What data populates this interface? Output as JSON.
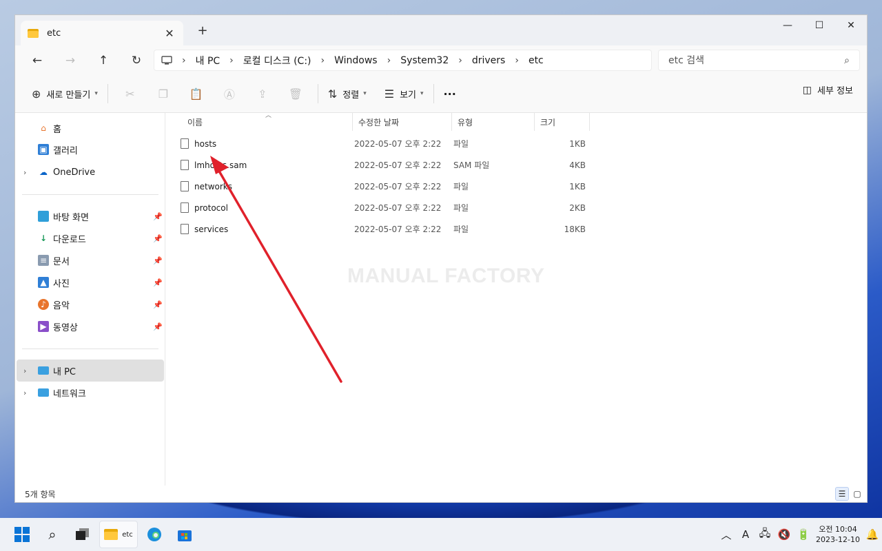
{
  "window": {
    "tab_title": "etc",
    "tab_close": "✕",
    "new_tab": "+",
    "controls": {
      "minimize": "—",
      "maximize": "☐",
      "close": "✕"
    }
  },
  "nav": {
    "back": "←",
    "forward": "→",
    "up": "↑",
    "refresh": "↻",
    "breadcrumb": [
      "내 PC",
      "로컬 디스크 (C:)",
      "Windows",
      "System32",
      "drivers",
      "etc"
    ],
    "search_placeholder": "etc 검색"
  },
  "toolbar": {
    "new_label": "새로 만들기",
    "sort_label": "정렬",
    "view_label": "보기",
    "more_label": "···",
    "details_label": "세부 정보"
  },
  "sidebar": {
    "top": [
      {
        "label": "홈",
        "icon": "home-icon"
      },
      {
        "label": "갤러리",
        "icon": "gallery-icon"
      },
      {
        "label": "OneDrive",
        "icon": "onedrive-icon"
      }
    ],
    "quick": [
      {
        "label": "바탕 화면",
        "icon": "desktop-icon"
      },
      {
        "label": "다운로드",
        "icon": "download-icon"
      },
      {
        "label": "문서",
        "icon": "documents-icon"
      },
      {
        "label": "사진",
        "icon": "pictures-icon"
      },
      {
        "label": "음악",
        "icon": "music-icon"
      },
      {
        "label": "동영상",
        "icon": "videos-icon"
      }
    ],
    "bottom": [
      {
        "label": "내 PC",
        "icon": "pc-icon"
      },
      {
        "label": "네트워크",
        "icon": "network-icon"
      }
    ]
  },
  "columns": {
    "name": "이름",
    "date": "수정한 날짜",
    "type": "유형",
    "size": "크기"
  },
  "files": [
    {
      "name": "hosts",
      "date": "2022-05-07 오후 2:22",
      "type": "파일",
      "size": "1KB"
    },
    {
      "name": "lmhosts.sam",
      "date": "2022-05-07 오후 2:22",
      "type": "SAM 파일",
      "size": "4KB"
    },
    {
      "name": "networks",
      "date": "2022-05-07 오후 2:22",
      "type": "파일",
      "size": "1KB"
    },
    {
      "name": "protocol",
      "date": "2022-05-07 오후 2:22",
      "type": "파일",
      "size": "2KB"
    },
    {
      "name": "services",
      "date": "2022-05-07 오후 2:22",
      "type": "파일",
      "size": "18KB"
    }
  ],
  "watermark": "MANUAL FACTORY",
  "status": {
    "item_count": "5개 항목"
  },
  "taskbar": {
    "explorer_label": "etc",
    "clock_time": "오전 10:04",
    "clock_date": "2023-12-10",
    "ime": "A"
  },
  "colors": {
    "accent": "#0067c0",
    "annotation_arrow": "#e0212b",
    "folder": "#ffc83d"
  }
}
